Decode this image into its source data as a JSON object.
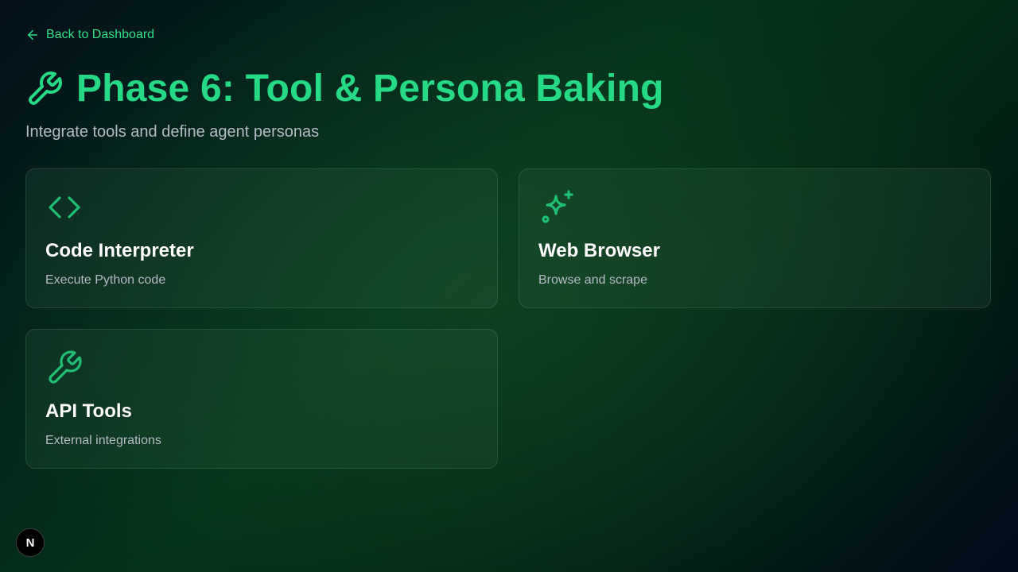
{
  "nav": {
    "back_label": "Back to Dashboard",
    "back_icon": "arrow-left-icon"
  },
  "header": {
    "icon": "wrench-icon",
    "title": "Phase 6: Tool & Persona Baking",
    "subtitle": "Integrate tools and define agent personas"
  },
  "cards": [
    {
      "icon": "code-icon",
      "title": "Code Interpreter",
      "description": "Execute Python code"
    },
    {
      "icon": "sparkles-icon",
      "title": "Web Browser",
      "description": "Browse and scrape"
    },
    {
      "icon": "wrench-icon",
      "title": "API Tools",
      "description": "External integrations"
    }
  ],
  "badge": {
    "label": "N"
  },
  "colors": {
    "accent": "#25d985",
    "icon_green": "#1fbf74",
    "text_muted": "#b3bcc4"
  }
}
